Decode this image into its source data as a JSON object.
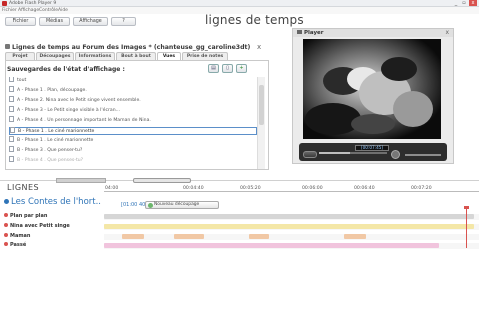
{
  "window": {
    "title": "Adobe Flash Player 9",
    "controls": {
      "minimize": "_",
      "restore": "▫",
      "close": "x"
    }
  },
  "menu": {
    "items": [
      "Fichier",
      "Affichage",
      "Contrôle",
      "Aide"
    ]
  },
  "toolbar": {
    "buttons": [
      "Fichier",
      "Médias",
      "Affichage",
      "?"
    ]
  },
  "app_title": "lignes de temps",
  "player": {
    "label": "Player",
    "close": "x",
    "timecode": "[00:07:45]",
    "seek_progress": 0.45
  },
  "document": {
    "title": "Lignes de temps au Forum des Images * (chanteuse_gg_caroline3dt)",
    "close": "x",
    "tabs": [
      "Projet",
      "Découpages",
      "Informations",
      "Bout à bout",
      "Vues",
      "Prise de notes"
    ],
    "active_tab": "Vues",
    "panel_heading": "Sauvegardes de l'état d'affichage :",
    "panel_buttons": [
      "▤",
      "▯",
      "+"
    ],
    "rows": [
      "tout",
      "A - Phase 1 . Plan, découpage.",
      "A - Phase 2. Nina avec le Petit singe vivent ensemble.",
      "A - Phase 3 - Le Petit singe visible à l'écran...",
      "A - Phase 4 . Un personnage important le Maman de Nina.",
      "B - Phase 1 . Le ciné marionnette",
      "B - Phase 1 . Le ciné marionnette",
      "B - Phase 3 . Que penser-tu?",
      "B - Phase 4 . Que penses-tu?"
    ],
    "selected_row": 5
  },
  "timeline": {
    "lines_label": "LIGNES",
    "ruler_labels": [
      "04:00",
      "00:04:40",
      "00:05:20",
      "00:06:00",
      "00:06:40",
      "00:07:20"
    ],
    "project_title": "Les Contes de l'hort..",
    "project_time": "[01:00 40]",
    "new_cut_label": "Nouveau découpage",
    "tracks": [
      {
        "label": "Plan par plan"
      },
      {
        "label": "Nina avec Petit singe"
      },
      {
        "label": "Maman"
      },
      {
        "label": "Passé"
      }
    ]
  },
  "colors": {
    "accent": "#2f74b7",
    "plan_track": "#b7b7b7",
    "nina_track": "#f4e7a7",
    "maman_track": "#f1c8a5",
    "passe_track": "#f1c4dd",
    "playhead": "#d9534f"
  }
}
